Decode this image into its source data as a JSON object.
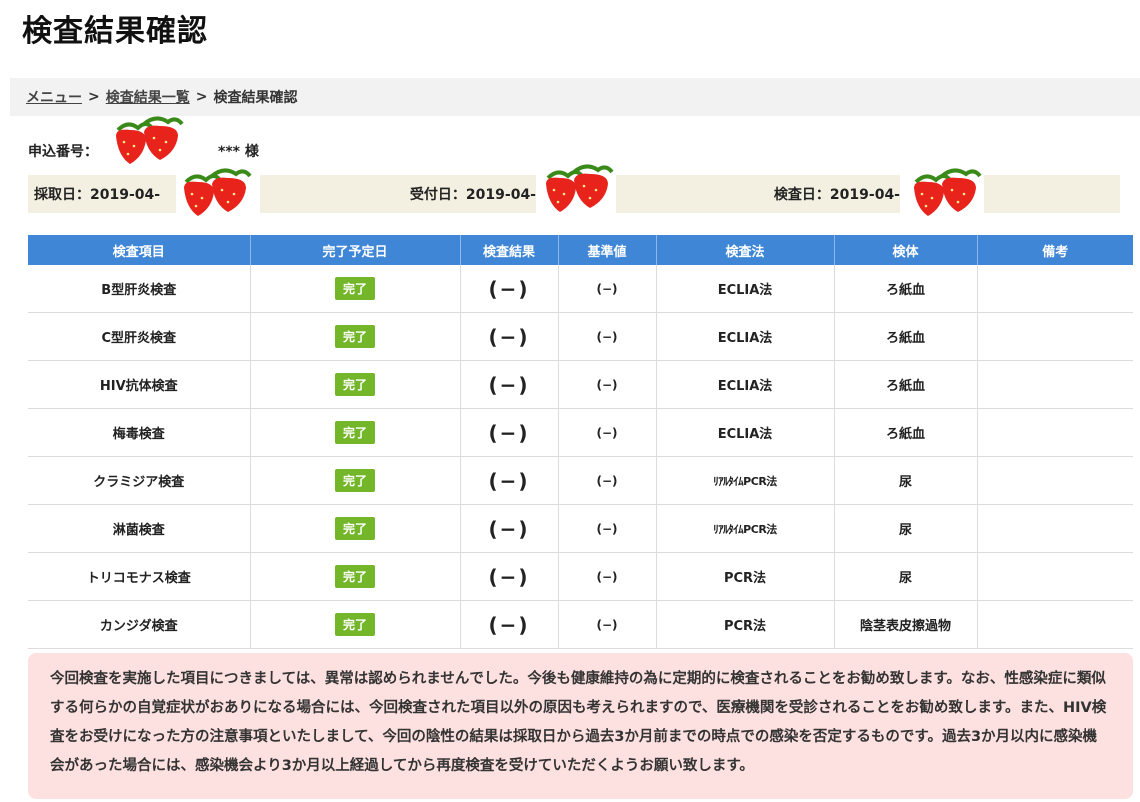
{
  "page": {
    "title": "検査結果確認"
  },
  "breadcrumb": {
    "menu": "メニュー",
    "list": "検査結果一覧",
    "current": "検査結果確認",
    "separator": ">"
  },
  "applicant": {
    "label": "申込番号：",
    "name": "*** 様"
  },
  "dates": {
    "collected": "採取日：2019-04-",
    "received": "受付日：2019-04-",
    "tested": "検査日：2019-04-"
  },
  "table": {
    "headers": [
      "検査項目",
      "完了予定日",
      "検査結果",
      "基準値",
      "検査法",
      "検体",
      "備考"
    ],
    "rows": [
      {
        "item": "B型肝炎検査",
        "status": "完了",
        "result": "(−)",
        "standard": "(−)",
        "method": "ECLIA法",
        "specimen": "ろ紙血",
        "note": ""
      },
      {
        "item": "C型肝炎検査",
        "status": "完了",
        "result": "(−)",
        "standard": "(−)",
        "method": "ECLIA法",
        "specimen": "ろ紙血",
        "note": ""
      },
      {
        "item": "HIV抗体検査",
        "status": "完了",
        "result": "(−)",
        "standard": "(−)",
        "method": "ECLIA法",
        "specimen": "ろ紙血",
        "note": ""
      },
      {
        "item": "梅毒検査",
        "status": "完了",
        "result": "(−)",
        "standard": "(−)",
        "method": "ECLIA法",
        "specimen": "ろ紙血",
        "note": ""
      },
      {
        "item": "クラミジア検査",
        "status": "完了",
        "result": "(−)",
        "standard": "(−)",
        "method": "ﾘｱﾙﾀｲﾑPCR法",
        "specimen": "尿",
        "note": ""
      },
      {
        "item": "淋菌検査",
        "status": "完了",
        "result": "(−)",
        "standard": "(−)",
        "method": "ﾘｱﾙﾀｲﾑPCR法",
        "specimen": "尿",
        "note": ""
      },
      {
        "item": "トリコモナス検査",
        "status": "完了",
        "result": "(−)",
        "standard": "(−)",
        "method": "PCR法",
        "specimen": "尿",
        "note": ""
      },
      {
        "item": "カンジダ検査",
        "status": "完了",
        "result": "(−)",
        "standard": "(−)",
        "method": "PCR法",
        "specimen": "陰茎表皮擦過物",
        "note": ""
      }
    ]
  },
  "note": {
    "text": "今回検査を実施した項目につきましては、異常は認められませんでした。今後も健康維持の為に定期的に検査されることをお勧め致します。なお、性感染症に類似する何らかの自覚症状がおありになる場合には、今回検査された項目以外の原因も考えられますので、医療機関を受診されることをお勧め致します。また、HIV検査をお受けになった方の注意事項といたしまして、今回の陰性の結果は採取日から過去3か月前までの時点での感染を否定するものです。過去3か月以内に感染機会があった場合には、感染機会より3か月以上経過してから再度検査を受けていただくようお願い致します。"
  },
  "colors": {
    "header_blue": "#3f86d6",
    "badge_green": "#74b62a",
    "note_pink": "#fde0e0",
    "date_beige": "#f3f0e2"
  },
  "icons": {
    "redaction": "strawberry-icon"
  }
}
